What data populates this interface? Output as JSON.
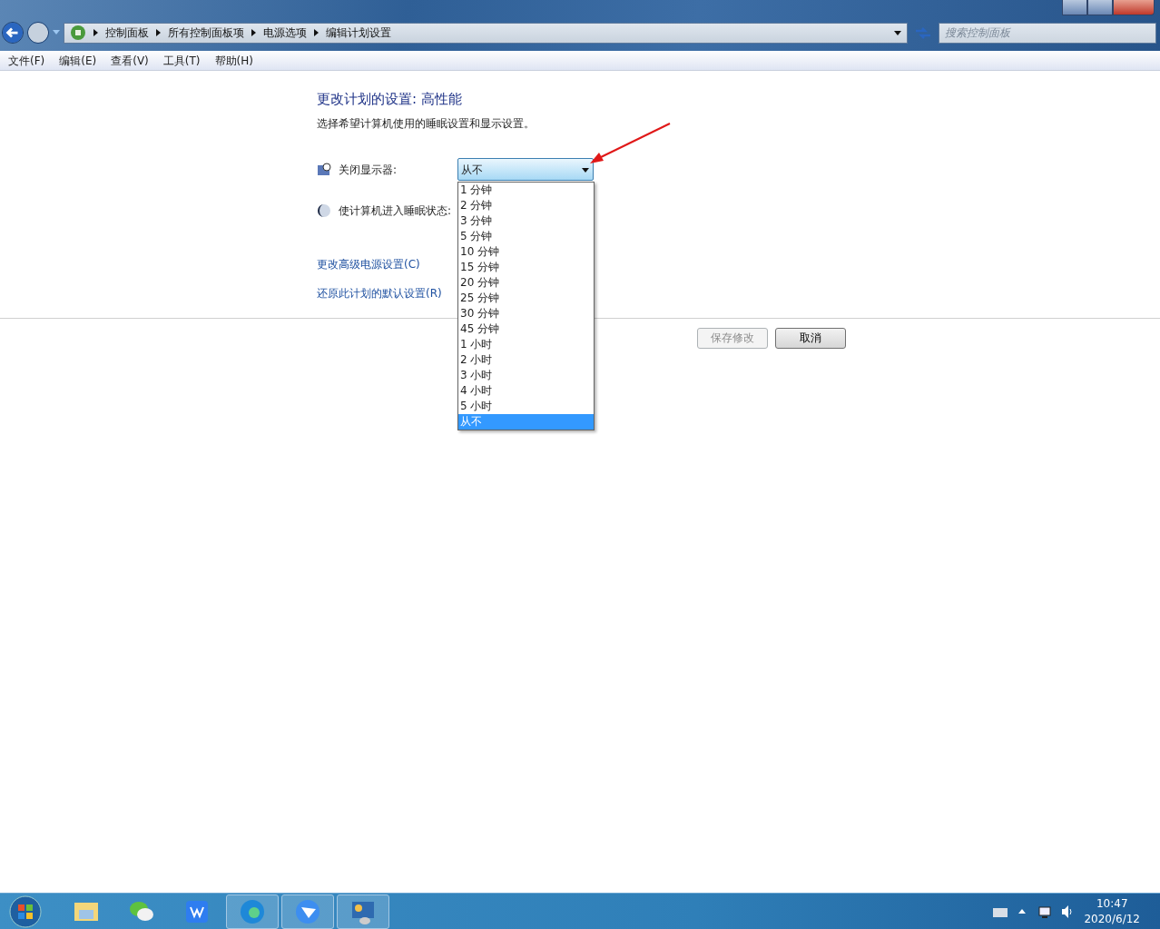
{
  "window": {
    "breadcrumb": [
      "控制面板",
      "所有控制面板项",
      "电源选项",
      "编辑计划设置"
    ],
    "search": {
      "placeholder": "搜索控制面板"
    },
    "menu": [
      "文件(F)",
      "编辑(E)",
      "查看(V)",
      "工具(T)",
      "帮助(H)"
    ]
  },
  "page": {
    "title": "更改计划的设置: 高性能",
    "subtitle": "选择希望计算机使用的睡眠设置和显示设置。",
    "settings": [
      {
        "kind": "display",
        "label": "关闭显示器:",
        "value": "从不",
        "expanded": true
      },
      {
        "kind": "sleep",
        "label": "使计算机进入睡眠状态:"
      }
    ],
    "options": [
      {
        "label": "1 分钟",
        "selected": false
      },
      {
        "label": "2 分钟",
        "selected": false
      },
      {
        "label": "3 分钟",
        "selected": false
      },
      {
        "label": "5 分钟",
        "selected": false
      },
      {
        "label": "10 分钟",
        "selected": false
      },
      {
        "label": "15 分钟",
        "selected": false
      },
      {
        "label": "20 分钟",
        "selected": false
      },
      {
        "label": "25 分钟",
        "selected": false
      },
      {
        "label": "30 分钟",
        "selected": false
      },
      {
        "label": "45 分钟",
        "selected": false
      },
      {
        "label": "1 小时",
        "selected": false
      },
      {
        "label": "2 小时",
        "selected": false
      },
      {
        "label": "3 小时",
        "selected": false
      },
      {
        "label": "4 小时",
        "selected": false
      },
      {
        "label": "5 小时",
        "selected": false
      },
      {
        "label": "从不",
        "selected": true
      }
    ],
    "links": [
      "更改高级电源设置(C)",
      "还原此计划的默认设置(R)"
    ],
    "buttons": [
      {
        "label": "保存修改",
        "disabled": true
      },
      {
        "label": "取消",
        "disabled": false
      }
    ]
  },
  "taskbar": {
    "apps": [
      {
        "kind": "folder",
        "running": false
      },
      {
        "kind": "chat",
        "running": false
      },
      {
        "kind": "office",
        "running": false
      },
      {
        "kind": "browser",
        "running": true
      },
      {
        "kind": "messenger",
        "running": true
      },
      {
        "kind": "control-panel",
        "running": true
      }
    ],
    "time": "10:47",
    "date": "2020/6/12"
  }
}
